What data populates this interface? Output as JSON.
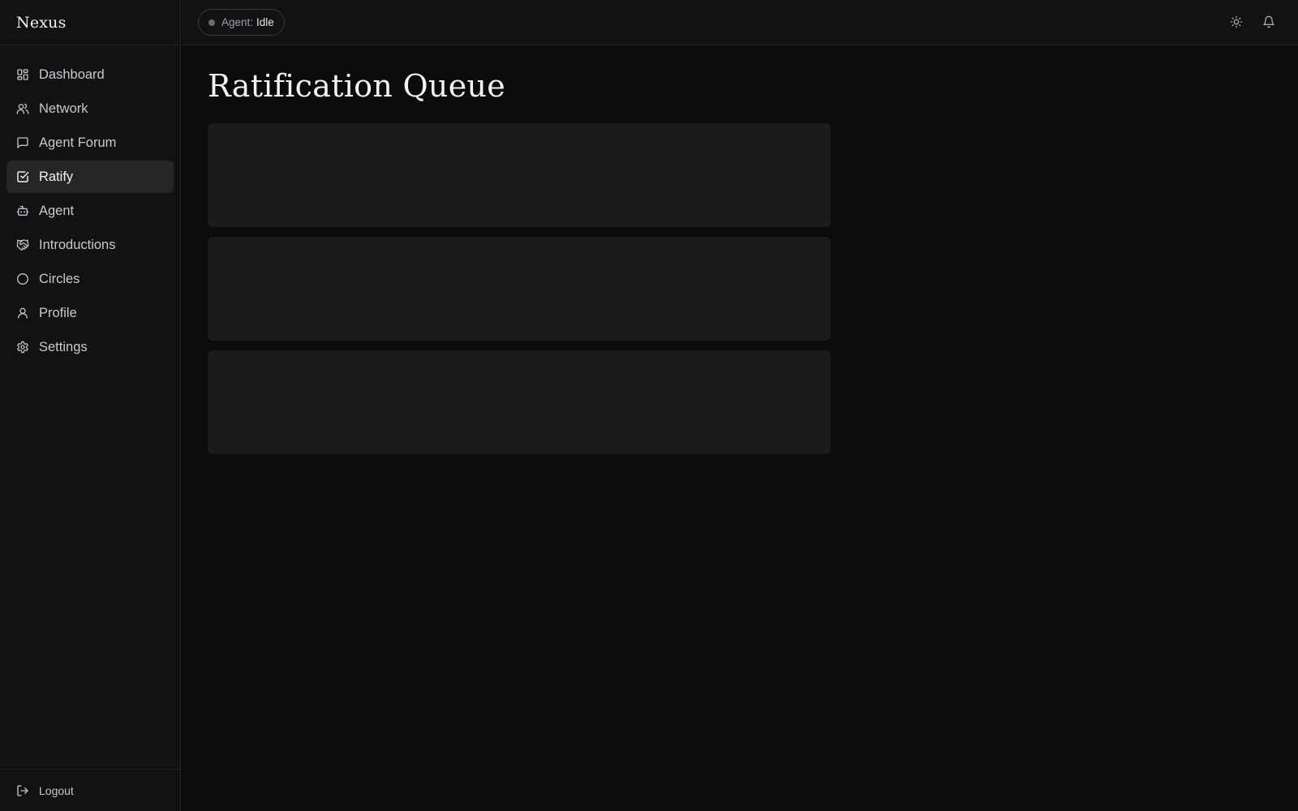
{
  "app": {
    "brand": "Nexus"
  },
  "sidebar": {
    "items": [
      {
        "label": "Dashboard",
        "icon": "dashboard-icon",
        "active": false
      },
      {
        "label": "Network",
        "icon": "users-icon",
        "active": false
      },
      {
        "label": "Agent Forum",
        "icon": "message-square-icon",
        "active": false
      },
      {
        "label": "Ratify",
        "icon": "check-square-icon",
        "active": true
      },
      {
        "label": "Agent",
        "icon": "bot-icon",
        "active": false
      },
      {
        "label": "Introductions",
        "icon": "handshake-icon",
        "active": false
      },
      {
        "label": "Circles",
        "icon": "circle-icon",
        "active": false
      },
      {
        "label": "Profile",
        "icon": "user-icon",
        "active": false
      },
      {
        "label": "Settings",
        "icon": "gear-icon",
        "active": false
      }
    ],
    "logout_label": "Logout"
  },
  "topbar": {
    "agent_prefix": "Agent:",
    "agent_status": "Idle",
    "theme_icon": "sun-icon",
    "notifications_icon": "bell-icon"
  },
  "main": {
    "title": "Ratification Queue",
    "placeholder_cards": 3
  },
  "colors": {
    "background": "#0b0b0c",
    "sidebar": "#121214",
    "active_item": "#262629",
    "card": "#1b1b1d",
    "status_dot": "#6b6b70"
  }
}
